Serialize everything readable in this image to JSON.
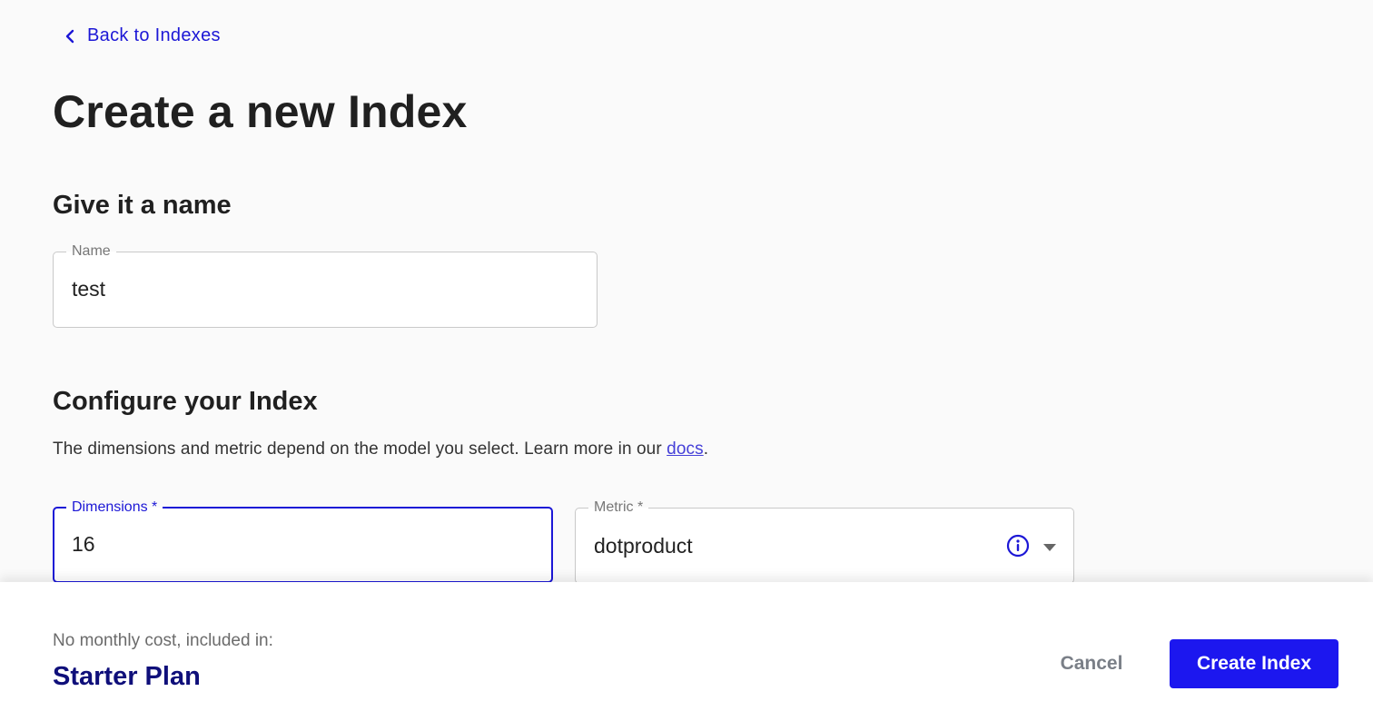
{
  "nav": {
    "back_label": "Back to Indexes",
    "back_icon": "chevron-left-icon"
  },
  "page": {
    "title": "Create a new Index"
  },
  "name_section": {
    "title": "Give it a name",
    "name_field": {
      "label": "Name",
      "value": "test"
    }
  },
  "config_section": {
    "title": "Configure your Index",
    "description_prefix": "The dimensions and metric depend on the model you select. Learn more in our ",
    "docs_link": "docs",
    "description_suffix": ".",
    "dimensions_field": {
      "label": "Dimensions *",
      "value": "16",
      "focused": true
    },
    "metric_field": {
      "label": "Metric *",
      "value": "dotproduct",
      "info_icon": "info-icon",
      "dropdown_icon": "caret-down-icon"
    }
  },
  "footer": {
    "plan_caption": "No monthly cost, included in:",
    "plan_name": "Starter Plan",
    "cancel_label": "Cancel",
    "create_label": "Create Index"
  },
  "colors": {
    "accent": "#1c17ef",
    "link": "#1c17d6",
    "plan_name": "#0f0f7a",
    "background": "#fafafa"
  }
}
